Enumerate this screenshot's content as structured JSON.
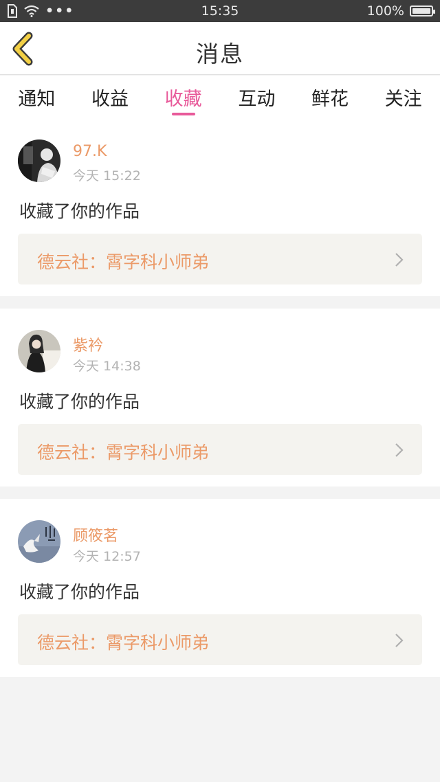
{
  "status_bar": {
    "time": "15:35",
    "battery": "100%",
    "dots": "•••"
  },
  "nav": {
    "title": "消息"
  },
  "tabs": [
    {
      "label": "通知"
    },
    {
      "label": "收益"
    },
    {
      "label": "收藏"
    },
    {
      "label": "互动"
    },
    {
      "label": "鲜花"
    },
    {
      "label": "关注"
    }
  ],
  "active_tab": "收藏",
  "messages": [
    {
      "username": "97.K",
      "time": "今天 15:22",
      "action": "收藏了你的作品",
      "work": "德云社：霄字科小师弟"
    },
    {
      "username": "紫衿",
      "time": "今天 14:38",
      "action": "收藏了你的作品",
      "work": "德云社：霄字科小师弟"
    },
    {
      "username": "顾筱茗",
      "time": "今天 12:57",
      "action": "收藏了你的作品",
      "work": "德云社：霄字科小师弟"
    }
  ],
  "colors": {
    "accent_pink": "#e85a9a",
    "username_orange": "#eb9a68",
    "back_arrow_yellow": "#f3d045"
  }
}
